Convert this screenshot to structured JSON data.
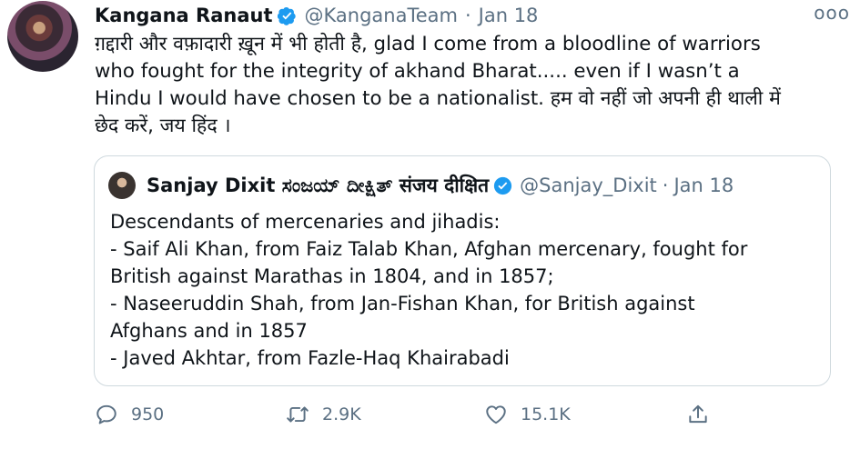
{
  "tweet": {
    "author_name": "Kangana Ranaut",
    "author_handle": "@KanganaTeam",
    "separator": "·",
    "date": "Jan 18",
    "more_label": "ooo",
    "text": "ग़द्दारी और वफ़ादारी ख़ून में भी होती है, glad I come from a bloodline of warriors\nwho fought for the integrity of akhand Bharat..... even if I wasn’t a\nHindu I would have chosen to be a nationalist. हम वो नहीं जो अपनी ही थाली में\nछेद करें, जय हिंद ।"
  },
  "quoted_tweet": {
    "author_name": "Sanjay Dixit ಸಂಜಯ್ ದೀಕ್ಷಿತ್ संजय दीक्षित",
    "author_handle": "@Sanjay_Dixit",
    "separator": "·",
    "date": "Jan 18",
    "text": "Descendants of mercenaries and jihadis:\n- Saif Ali Khan, from Faiz Talab Khan, Afghan mercenary, fought for\nBritish against Marathas in 1804, and in 1857;\n- Naseeruddin Shah, from Jan-Fishan Khan, for British against\nAfghans and in 1857\n- Javed Akhtar, from Fazle-Haq Khairabadi"
  },
  "actions": {
    "reply_count": "950",
    "retweet_count": "2.9K",
    "like_count": "15.1K"
  },
  "colors": {
    "verified": "#1d9bf0",
    "secondary_text": "#5b7083",
    "border": "#cfd9de"
  },
  "icons": [
    "verified-badge-icon",
    "reply-icon",
    "retweet-icon",
    "like-icon",
    "share-icon",
    "more-icon"
  ]
}
